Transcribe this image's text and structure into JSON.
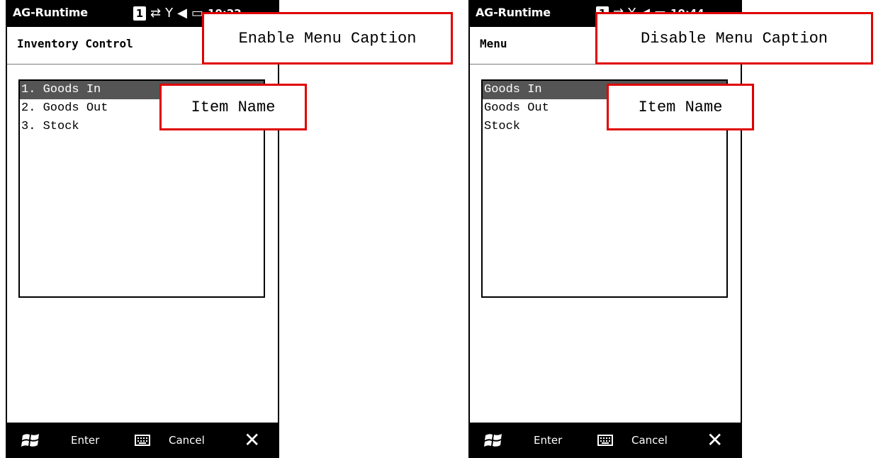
{
  "left_screen": {
    "status_title": "AG-Runtime",
    "sim_indicator": "1",
    "clock": "10:22",
    "caption": "Inventory Control",
    "items": [
      "1. Goods In",
      "2. Goods Out",
      "3. Stock"
    ],
    "selected_index": 0,
    "softkey_left": "Enter",
    "softkey_right": "Cancel",
    "callout_caption": "Enable Menu Caption",
    "callout_item": "Item Name"
  },
  "right_screen": {
    "status_title": "AG-Runtime",
    "sim_indicator": "1",
    "clock": "10:44",
    "caption": "Menu",
    "items": [
      "Goods In",
      "Goods Out",
      "Stock"
    ],
    "selected_index": 0,
    "softkey_left": "Enter",
    "softkey_right": "Cancel",
    "callout_caption": "Disable Menu Caption",
    "callout_item": "Item Name"
  },
  "colors": {
    "callout_border": "#e00000",
    "selection": "#555555",
    "bar": "#000000"
  },
  "icons": [
    "windows-start-icon",
    "keyboard-icon",
    "close-icon",
    "signal-icon",
    "sync-icon",
    "volume-icon",
    "battery-icon"
  ]
}
